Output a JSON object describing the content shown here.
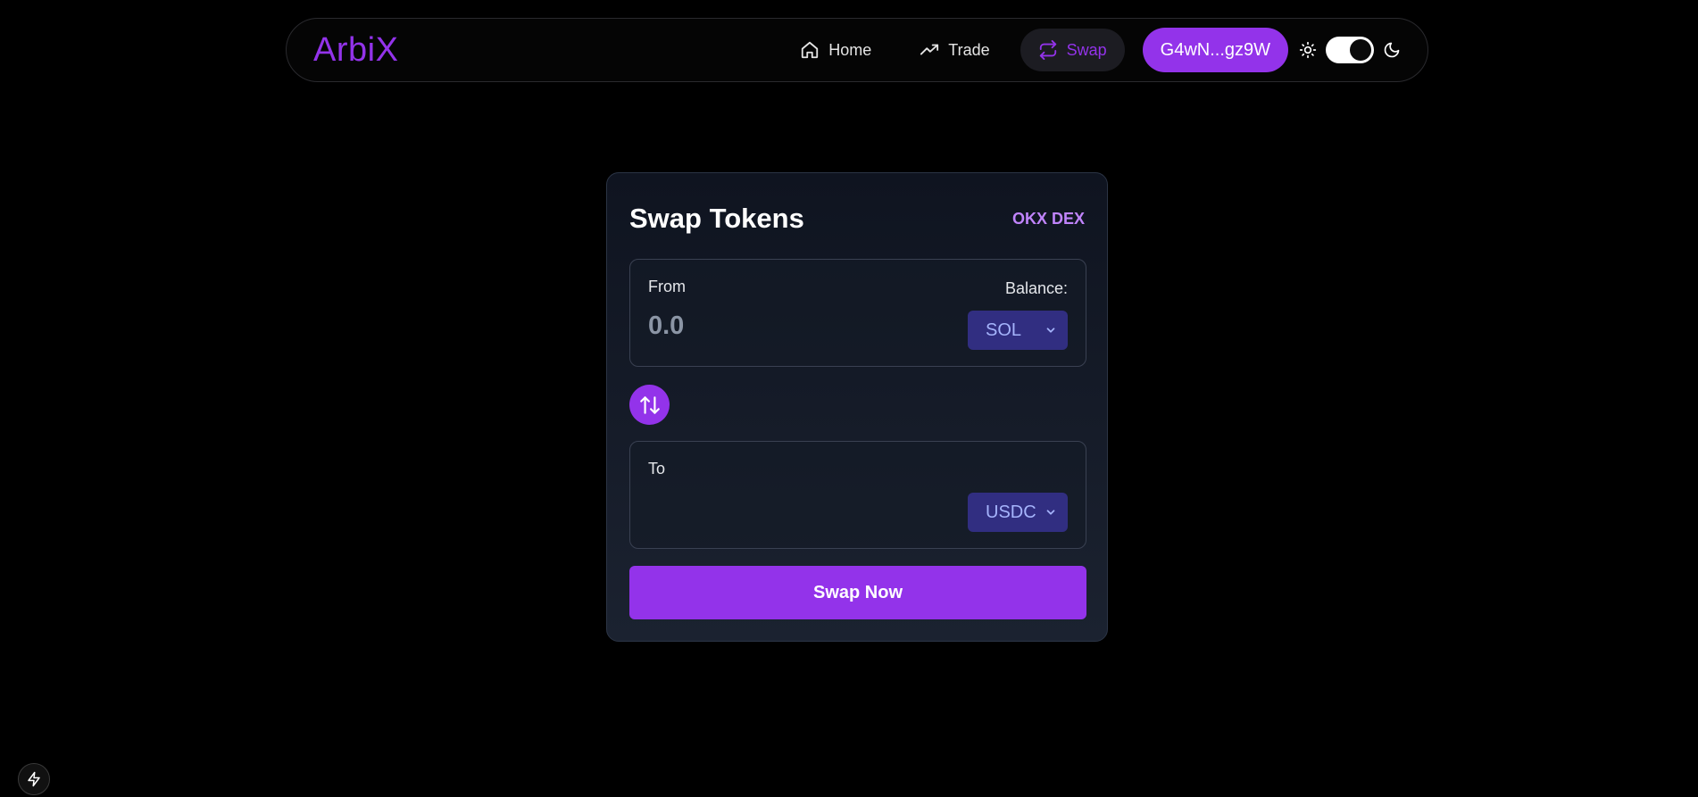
{
  "nav": {
    "logo": "ArbiX",
    "links": [
      {
        "label": "Home",
        "icon": "home-icon"
      },
      {
        "label": "Trade",
        "icon": "trending-up-icon"
      },
      {
        "label": "Swap",
        "icon": "repeat-icon",
        "active": true
      }
    ],
    "wallet": "G4wN...gz9W",
    "theme": "dark"
  },
  "swap": {
    "title": "Swap Tokens",
    "provider": "OKX DEX",
    "from": {
      "label": "From",
      "balance_label": "Balance:",
      "amount": "0.0",
      "token": "SOL"
    },
    "to": {
      "label": "To",
      "token": "USDC"
    },
    "submit": "Swap Now"
  },
  "colors": {
    "accent": "#9333ea",
    "accent_light": "#c084fc",
    "select_bg": "#312e81",
    "select_text": "#a5b4fc"
  }
}
